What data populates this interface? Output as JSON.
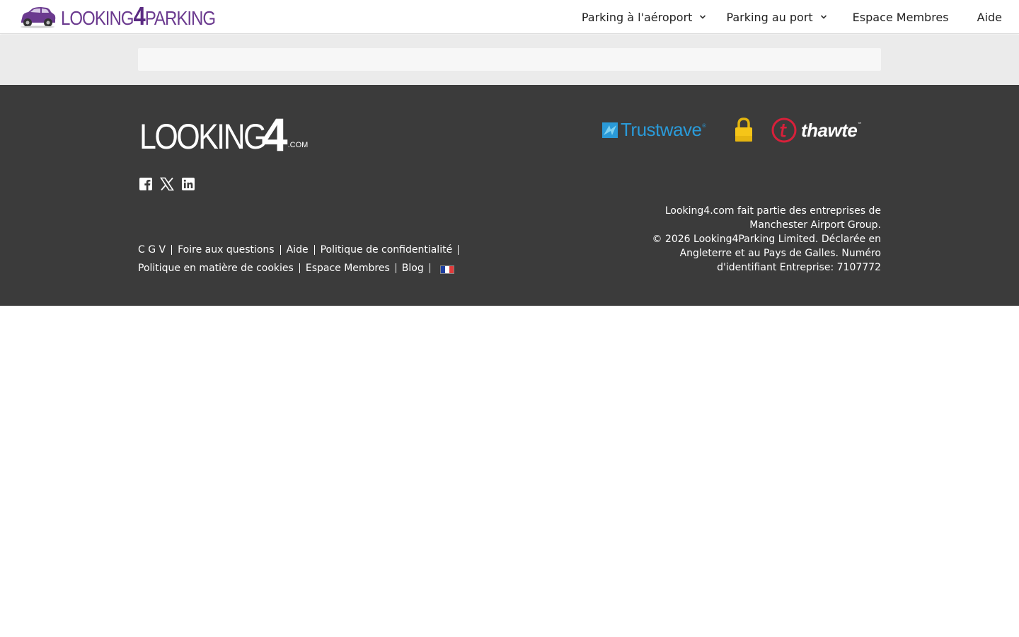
{
  "header": {
    "brand": {
      "word1": "LOOKING",
      "word2": "4",
      "word3": "PARKING"
    },
    "nav": [
      {
        "label": "Parking à l'aéroport",
        "has_dropdown": true
      },
      {
        "label": "Parking au port",
        "has_dropdown": true
      },
      {
        "label": "Espace Membres",
        "has_dropdown": false
      },
      {
        "label": "Aide",
        "has_dropdown": false
      }
    ]
  },
  "footer": {
    "logo": {
      "text": "LOOKING",
      "digit": "4",
      "suffix": ".COM"
    },
    "social_icons": [
      "facebook-icon",
      "x-icon",
      "linkedin-icon"
    ],
    "badges": {
      "trustwave": "Trustwave",
      "thawte": "thawte"
    },
    "links_row1": [
      "C G V",
      "Foire aux questions",
      "Aide",
      "Politique de confidentialité"
    ],
    "links_row2": [
      "Politique en matière de cookies",
      "Espace Membres",
      "Blog"
    ],
    "legal": {
      "line1": "Looking4.com fait partie des entreprises de Manchester Airport Group.",
      "line2": "© 2026 Looking4Parking Limited. Déclarée en Angleterre et au Pays de Galles. Numéro d'identifiant Entreprise: 7107772"
    }
  },
  "colors": {
    "brand_purple": "#6b3a8f",
    "footer_bg": "#3b3b3b",
    "band_bg": "#ebebeb",
    "trustwave_blue": "#2a9ad8",
    "thawte_red": "#d8203a",
    "lock_yellow": "#f5c518"
  }
}
